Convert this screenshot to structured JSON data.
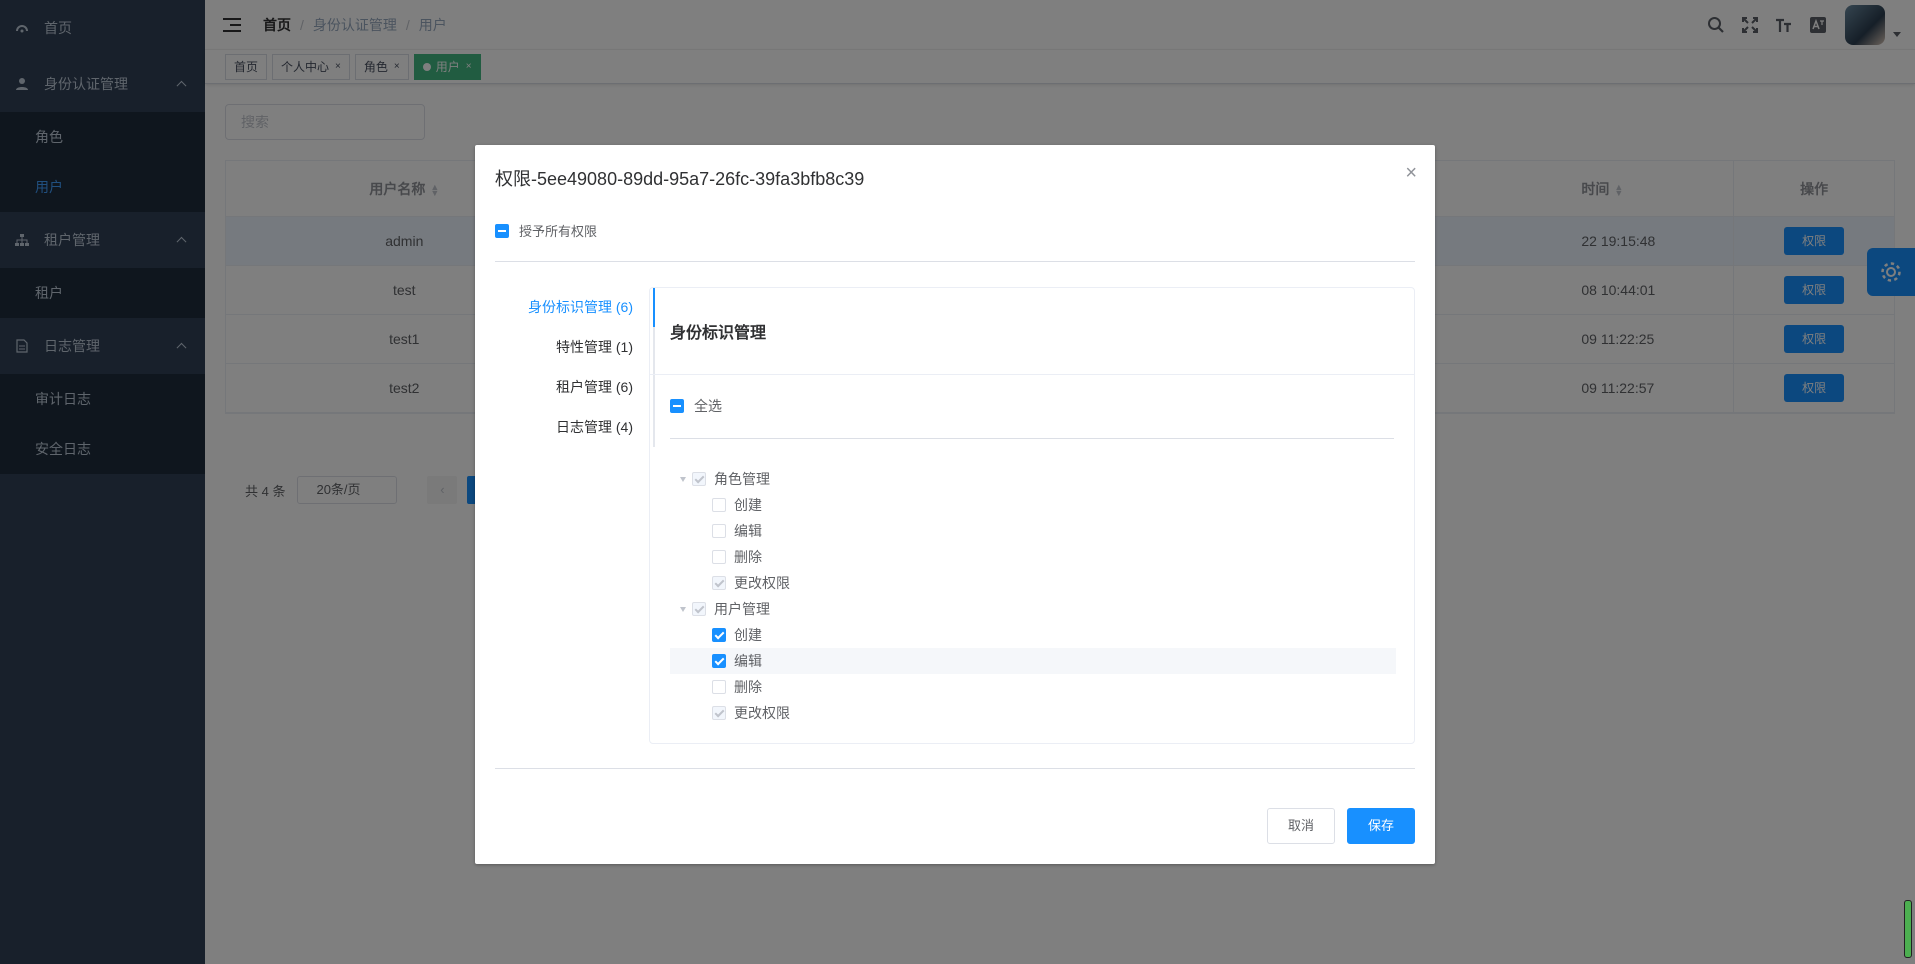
{
  "sidebar": {
    "items": [
      {
        "label": "首页"
      },
      {
        "label": "身份认证管理",
        "children": [
          {
            "label": "角色"
          },
          {
            "label": "用户"
          }
        ]
      },
      {
        "label": "租户管理",
        "children": [
          {
            "label": "租户"
          }
        ]
      },
      {
        "label": "日志管理",
        "children": [
          {
            "label": "审计日志"
          },
          {
            "label": "安全日志"
          }
        ]
      }
    ]
  },
  "breadcrumb": [
    "首页",
    "身份认证管理",
    "用户"
  ],
  "breadcrumb_sep": "/",
  "tags": [
    {
      "label": "首页"
    },
    {
      "label": "个人中心"
    },
    {
      "label": "角色"
    },
    {
      "label": "用户"
    }
  ],
  "tag_close": "×",
  "search": {
    "placeholder": "搜索"
  },
  "table": {
    "headers": {
      "username": "用户名称",
      "time": "时间",
      "actions": "操作"
    },
    "rows": [
      {
        "username": "admin",
        "time": "22 19:15:48",
        "action": "权限"
      },
      {
        "username": "test",
        "time": "08 10:44:01",
        "action": "权限"
      },
      {
        "username": "test1",
        "time": "09 11:22:25",
        "action": "权限"
      },
      {
        "username": "test2",
        "time": "09 11:22:57",
        "action": "权限"
      }
    ]
  },
  "pager": {
    "total": "共 4 条",
    "page_size": "20条/页",
    "prev": "‹"
  },
  "dialog": {
    "title": "权限-5ee49080-89dd-95a7-26fc-39fa3bfb8c39",
    "close": "×",
    "grant_all": "授予所有权限",
    "tabs": [
      {
        "label": "身份标识管理 (6)"
      },
      {
        "label": "特性管理 (1)"
      },
      {
        "label": "租户管理 (6)"
      },
      {
        "label": "日志管理 (4)"
      }
    ],
    "section_title": "身份标识管理",
    "select_all": "全选",
    "tree": [
      {
        "label": "角色管理",
        "children": [
          {
            "label": "创建"
          },
          {
            "label": "编辑"
          },
          {
            "label": "删除"
          },
          {
            "label": "更改权限"
          }
        ]
      },
      {
        "label": "用户管理",
        "children": [
          {
            "label": "创建"
          },
          {
            "label": "编辑"
          },
          {
            "label": "删除"
          },
          {
            "label": "更改权限"
          }
        ]
      }
    ],
    "cancel": "取消",
    "save": "保存"
  },
  "colors": {
    "primary": "#1890ff",
    "sidebar_bg": "#304156",
    "sidebar_sub_bg": "#1f2d3d",
    "active_tag": "#42b983"
  }
}
